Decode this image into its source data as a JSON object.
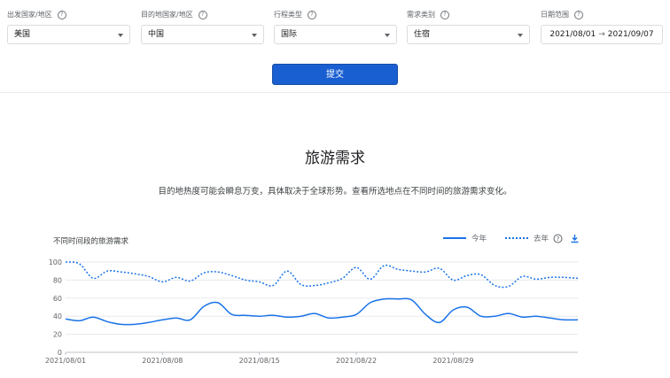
{
  "filters": {
    "origin": {
      "label": "出发国家/地区",
      "value": "美国"
    },
    "destination": {
      "label": "目的地国家/地区",
      "value": "中国"
    },
    "trip_type": {
      "label": "行程类型",
      "value": "国际"
    },
    "demand_type": {
      "label": "需求类别",
      "value": "住宿"
    },
    "date_range": {
      "label": "日期范围",
      "start": "2021/08/01",
      "end": "2021/09/07"
    }
  },
  "submit_label": "提交",
  "page": {
    "title": "旅游需求",
    "subtitle": "目的地热度可能会瞬息万变，具体取决于全球形势。查看所选地点在不同时间的旅游需求变化。"
  },
  "colors": {
    "accent": "#1a5fd1",
    "line": "#1a73e8"
  },
  "icons": {
    "help": "help-circle-icon",
    "download": "download-icon",
    "dropdown": "chevron-down-icon",
    "arrow": "arrow-right-icon"
  },
  "chart_data": {
    "type": "line",
    "title": "不同时间段的旅游需求",
    "xlabel": "",
    "ylabel": "",
    "ylim": [
      0,
      100
    ],
    "yticks": [
      0,
      20,
      40,
      60,
      80,
      100
    ],
    "grid": true,
    "legend_position": "top-right",
    "x": [
      "2021/08/01",
      "2021/08/02",
      "2021/08/03",
      "2021/08/04",
      "2021/08/05",
      "2021/08/06",
      "2021/08/07",
      "2021/08/08",
      "2021/08/09",
      "2021/08/10",
      "2021/08/11",
      "2021/08/12",
      "2021/08/13",
      "2021/08/14",
      "2021/08/15",
      "2021/08/16",
      "2021/08/17",
      "2021/08/18",
      "2021/08/19",
      "2021/08/20",
      "2021/08/21",
      "2021/08/22",
      "2021/08/23",
      "2021/08/24",
      "2021/08/25",
      "2021/08/26",
      "2021/08/27",
      "2021/08/28",
      "2021/08/29",
      "2021/08/30",
      "2021/08/31",
      "2021/09/01",
      "2021/09/02",
      "2021/09/03",
      "2021/09/04",
      "2021/09/05",
      "2021/09/06",
      "2021/09/07"
    ],
    "xticks": [
      "2021/08/01",
      "2021/08/08",
      "2021/08/15",
      "2021/08/22",
      "2021/08/29"
    ],
    "series": [
      {
        "name": "今年",
        "style": "solid",
        "values": [
          37,
          35,
          39,
          34,
          31,
          31,
          33,
          36,
          38,
          36,
          51,
          55,
          42,
          41,
          40,
          41,
          39,
          40,
          43,
          38,
          39,
          42,
          55,
          59,
          59,
          58,
          42,
          33,
          47,
          50,
          40,
          40,
          43,
          39,
          40,
          38,
          36,
          36
        ]
      },
      {
        "name": "去年",
        "style": "dashed",
        "values": [
          100,
          98,
          82,
          90,
          89,
          87,
          84,
          78,
          83,
          79,
          88,
          89,
          85,
          80,
          78,
          74,
          90,
          75,
          74,
          77,
          82,
          94,
          81,
          96,
          92,
          90,
          89,
          93,
          80,
          85,
          86,
          74,
          73,
          84,
          81,
          83,
          83,
          82
        ]
      }
    ]
  }
}
